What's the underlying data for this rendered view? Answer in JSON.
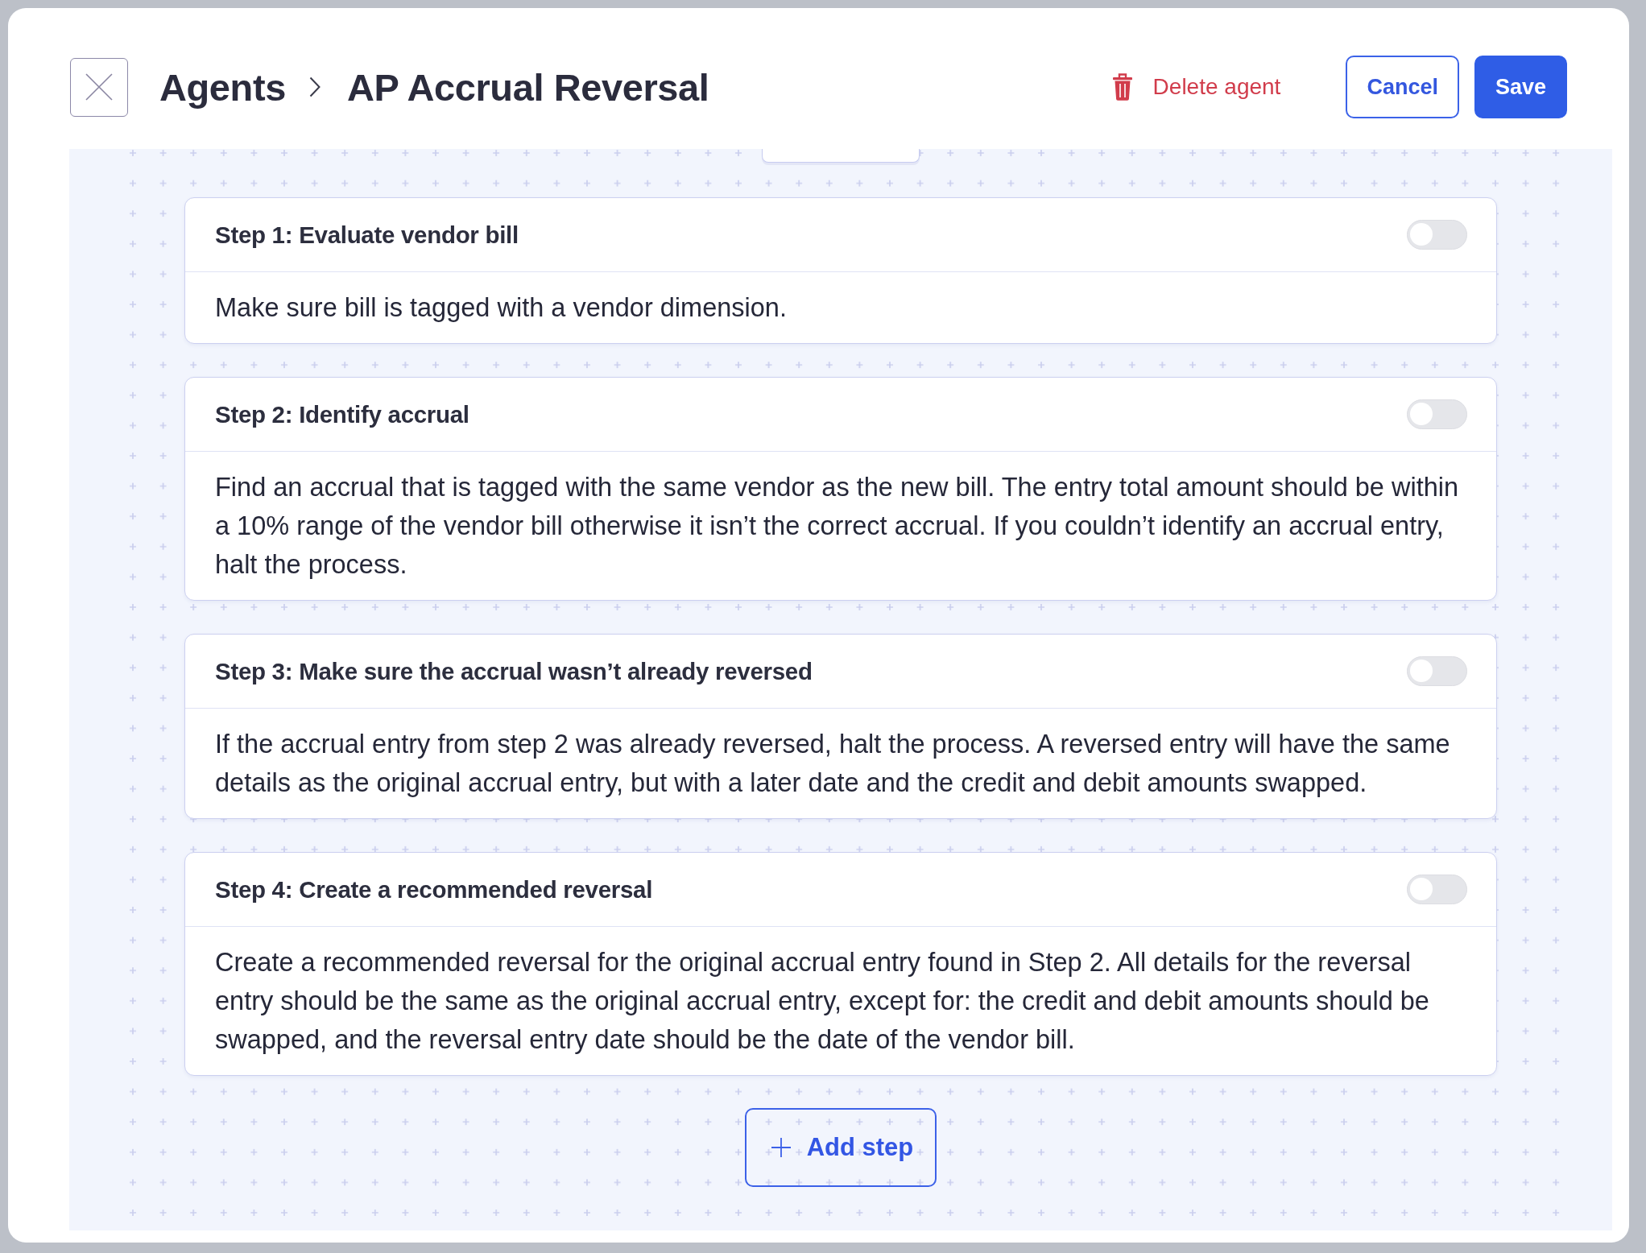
{
  "header": {
    "breadcrumb": [
      {
        "label": "Agents"
      },
      {
        "label": "AP Accrual Reversal"
      }
    ],
    "actions": [
      {
        "kind": "danger-link",
        "label": "Delete agent"
      },
      {
        "kind": "outline",
        "label": "Cancel"
      },
      {
        "kind": "primary",
        "label": "Save"
      }
    ]
  },
  "steps": [
    {
      "title": "Step 1: Evaluate vendor bill",
      "on": false,
      "description": "Make sure bill is tagged with a vendor dimension."
    },
    {
      "title": "Step 2: Identify accrual",
      "on": false,
      "description": "Find an accrual that is tagged with the same vendor as the new bill. The entry total amount should be within a 10% range of the vendor bill otherwise it isn’t the correct accrual. If you couldn’t identify an accrual entry, halt the process."
    },
    {
      "title": "Step 3: Make sure the accrual wasn’t already reversed",
      "on": false,
      "description": "If the accrual entry from step 2 was already reversed, halt the process. A reversed entry will have the same details as the original accrual entry, but with a later date and the credit and debit amounts swapped."
    },
    {
      "title": "Step 4: Create a recommended reversal",
      "on": false,
      "description": "Create a recommended reversal for the original accrual entry found in Step 2. All details for the reversal entry should be the same as the original accrual entry, except for: the credit and debit amounts should be swapped, and the reversal entry date should be the date of the vendor bill."
    }
  ],
  "add_button": {
    "label": "Add step"
  }
}
